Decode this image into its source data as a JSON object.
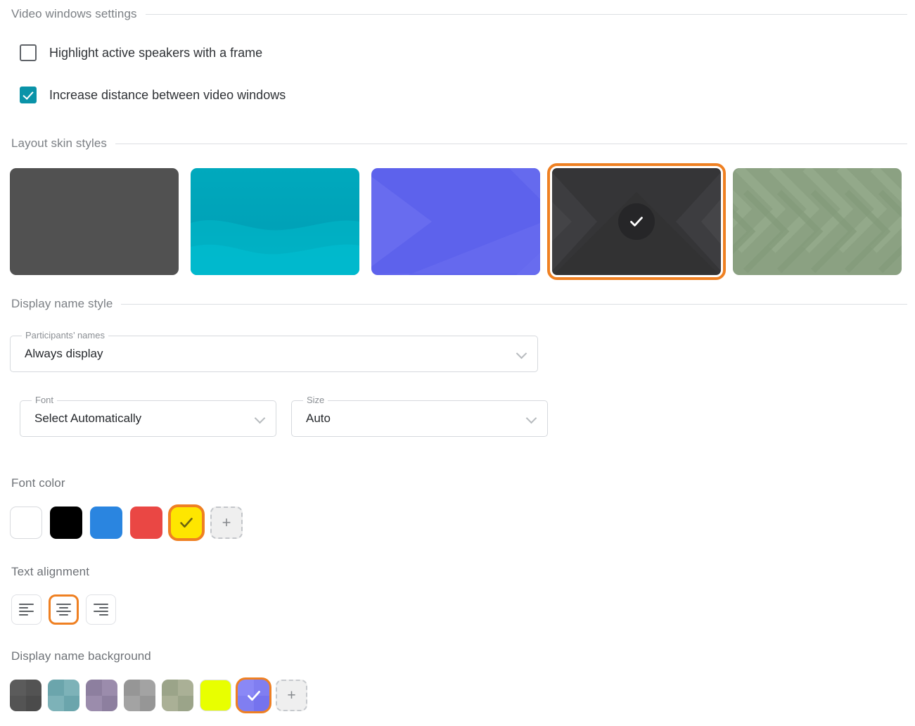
{
  "sections": {
    "video_windows": {
      "title": "Video windows settings",
      "checkboxes": [
        {
          "label": "Highlight active speakers with a frame",
          "checked": false
        },
        {
          "label": "Increase distance between video windows",
          "checked": true
        }
      ]
    },
    "layout_skins": {
      "title": "Layout skin styles",
      "selected_index": 3,
      "items": [
        {
          "name": "plain-dark-skin",
          "base_color": "#515151",
          "pattern": "solid",
          "selected": false
        },
        {
          "name": "teal-wave-skin",
          "base_color": "#00a6bb",
          "pattern": "waves",
          "selected": false
        },
        {
          "name": "blue-diagonal-skin",
          "base_color": "#5d62ec",
          "pattern": "diagonal",
          "selected": false
        },
        {
          "name": "dark-chevron-skin",
          "base_color": "#353537",
          "pattern": "chevron",
          "selected": true
        },
        {
          "name": "sage-chevron-skin",
          "base_color": "#8ba182",
          "pattern": "chevron-stripes",
          "selected": false
        }
      ]
    },
    "display_name_style": {
      "title": "Display name style",
      "fields": [
        {
          "legend": "Participants’ names",
          "value": "Always display",
          "icon": "chevron-down-icon"
        },
        {
          "legend": "Font",
          "value": "Select Automatically",
          "icon": "chevron-down-icon"
        },
        {
          "legend": "Size",
          "value": "Auto",
          "icon": "chevron-down-icon"
        }
      ]
    },
    "font_color": {
      "title": "Font color",
      "selected_index": 4,
      "swatches": [
        {
          "name": "white-swatch",
          "color": "#ffffff",
          "bordered": true,
          "selected": false
        },
        {
          "name": "black-swatch",
          "color": "#000000",
          "bordered": false,
          "selected": false
        },
        {
          "name": "blue-swatch",
          "color": "#2a85e0",
          "bordered": false,
          "selected": false
        },
        {
          "name": "red-swatch",
          "color": "#ea4744",
          "bordered": false,
          "selected": false
        },
        {
          "name": "yellow-swatch",
          "color": "#fee600",
          "bordered": false,
          "selected": true,
          "check_color": "#6b6410"
        }
      ],
      "add_label": "+"
    },
    "text_alignment": {
      "title": "Text alignment",
      "selected": "center",
      "options": [
        {
          "name": "align-left-button",
          "value": "left"
        },
        {
          "name": "align-center-button",
          "value": "center"
        },
        {
          "name": "align-right-button",
          "value": "right"
        }
      ]
    },
    "display_name_background": {
      "title": "Display name background",
      "selected_index": 6,
      "swatches": [
        {
          "name": "dark-gray-bg-swatch",
          "light": "#5b5b5b",
          "dark": "#4e4e4e",
          "checkered": true,
          "selected": false
        },
        {
          "name": "teal-bg-swatch",
          "light": "#77aeb4",
          "dark": "#629aa2",
          "checkered": true,
          "selected": false
        },
        {
          "name": "purple-bg-swatch",
          "light": "#9a8cad",
          "dark": "#86799c",
          "checkered": true,
          "selected": false
        },
        {
          "name": "gray-bg-swatch",
          "light": "#a3a3a3",
          "dark": "#919191",
          "checkered": true,
          "selected": false
        },
        {
          "name": "sage-bg-swatch",
          "light": "#aeb49c",
          "dark": "#9aa189",
          "checkered": true,
          "selected": false
        },
        {
          "name": "yellow-bg-swatch",
          "light": "#e8ff00",
          "dark": "#e8ff00",
          "checkered": false,
          "bordered": true,
          "selected": false
        },
        {
          "name": "periwinkle-bg-swatch",
          "light": "#8b89f5",
          "dark": "#7b79ef",
          "checkered": true,
          "selected": true,
          "check_color": "#ffffff"
        }
      ],
      "add_label": "+"
    }
  },
  "theme": {
    "accent_orange": "#ef8022",
    "checkbox_teal": "#0a93a8",
    "label_gray": "#7b7f84",
    "divider_gray": "#dcdfe3"
  }
}
